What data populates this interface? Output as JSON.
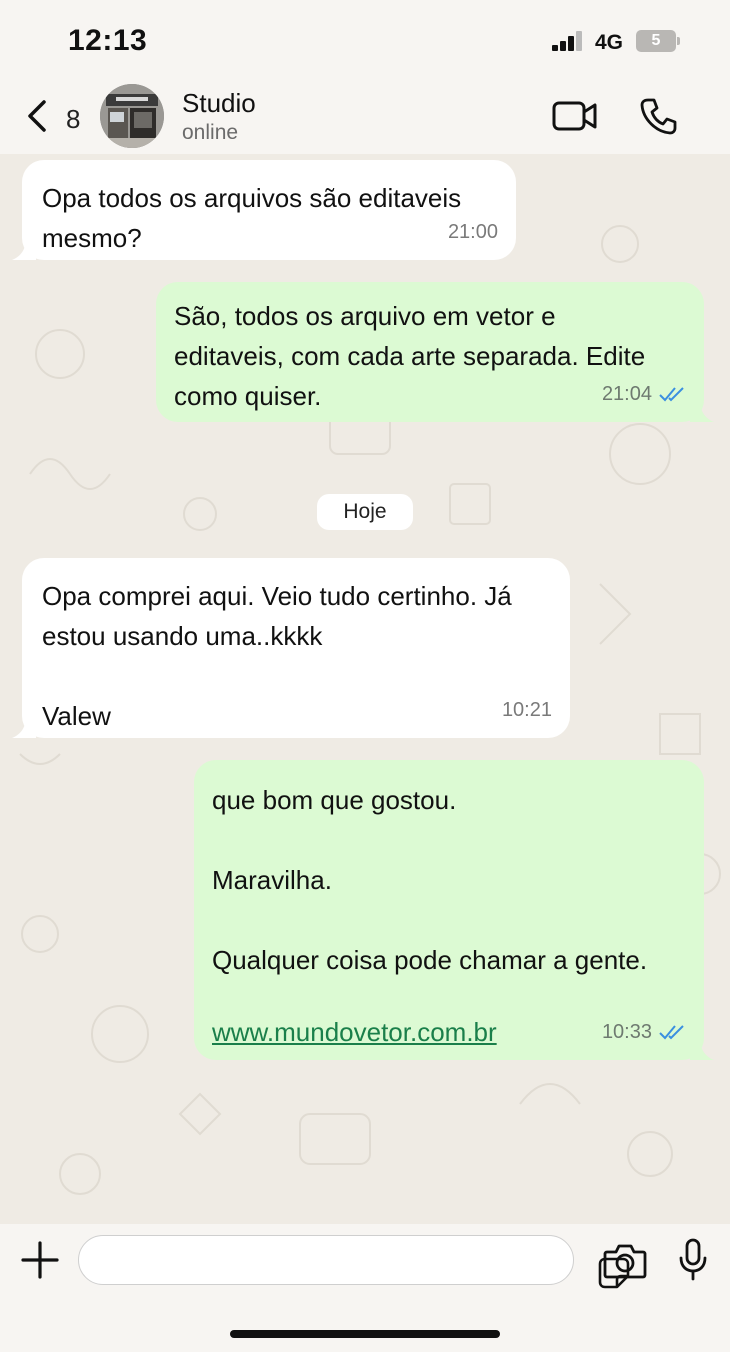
{
  "status": {
    "time": "12:13",
    "network": "4G",
    "battery": "5"
  },
  "header": {
    "back_count": "8",
    "contact_name": "Studio",
    "contact_status": "online",
    "icons": [
      "back-chevron-icon",
      "video-call-icon",
      "phone-icon"
    ]
  },
  "messages": [
    {
      "direction": "in",
      "text": "Opa todos os arquivos são editaveis\nmesmo?",
      "time": "21:00"
    },
    {
      "direction": "out",
      "text": "São, todos os arquivo em vetor e\neditaveis, com cada arte separada. Edite\ncomo quiser.",
      "time": "21:04",
      "read": true
    },
    {
      "direction": "in",
      "text": "Opa comprei aqui. Veio tudo certinho. Já\nestou usando uma..kkkk\n\nValew",
      "time": "10:21"
    },
    {
      "direction": "out",
      "text": "que bom que gostou.\n\nMaravilha.\n\nQualquer coisa pode chamar a gente.\n",
      "link": "www.mundovetor.com.br",
      "time": "10:33",
      "read": true
    }
  ],
  "date_divider": "Hoje",
  "colors": {
    "incoming": "#ffffff",
    "outgoing": "#dcfad3",
    "read_check": "#3a8fe0",
    "link": "#1a7f4a"
  },
  "input": {
    "placeholder": "",
    "icons": [
      "plus-icon",
      "sticker-icon",
      "camera-icon",
      "microphone-icon"
    ]
  }
}
